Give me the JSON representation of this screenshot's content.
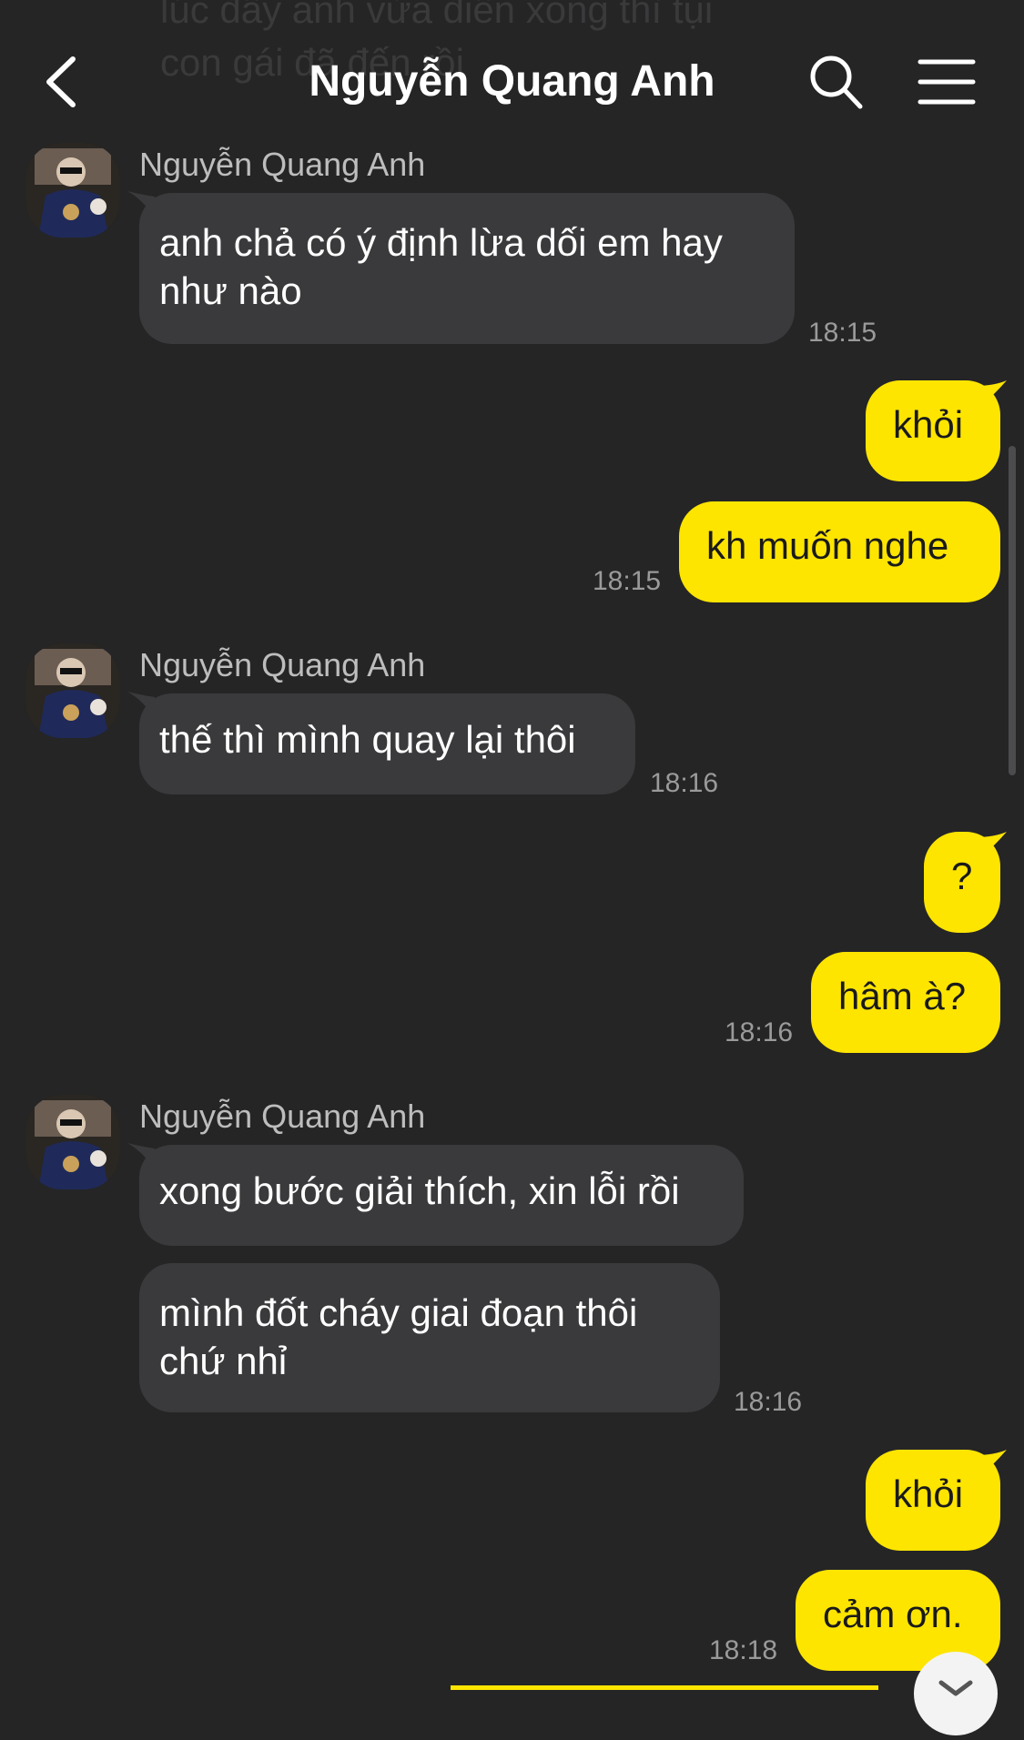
{
  "previous_message": {
    "text": "lúc đấy anh vừa điền xong thì tụi\ncon gái đã đến rồi"
  },
  "header": {
    "title": "Nguyễn Quang Anh",
    "back_icon": "chevron-left-icon",
    "search_icon": "search-icon",
    "menu_icon": "hamburger-menu-icon"
  },
  "colors": {
    "background": "#252526",
    "incoming_bubble": "#3a3a3c",
    "outgoing_bubble": "#fee500"
  },
  "messages": [
    {
      "sender": "Nguyễn Quang Anh",
      "text": "anh chả có ý định lừa dối em hay\nnhư nào",
      "time": "18:15"
    },
    {
      "text": "khỏi"
    },
    {
      "text": "kh muốn nghe",
      "time": "18:15"
    },
    {
      "sender": "Nguyễn Quang Anh",
      "text": "thế thì mình quay lại thôi",
      "time": "18:16"
    },
    {
      "text": "?"
    },
    {
      "text": "hâm à?",
      "time": "18:16"
    },
    {
      "sender": "Nguyễn Quang Anh",
      "text": "xong bước giải thích, xin lỗi rồi"
    },
    {
      "text": "mình đốt cháy giai đoạn thôi\nchứ nhỉ",
      "time": "18:16"
    },
    {
      "text": "khỏi"
    },
    {
      "text": "cảm ơn.",
      "time": "18:18"
    }
  ]
}
